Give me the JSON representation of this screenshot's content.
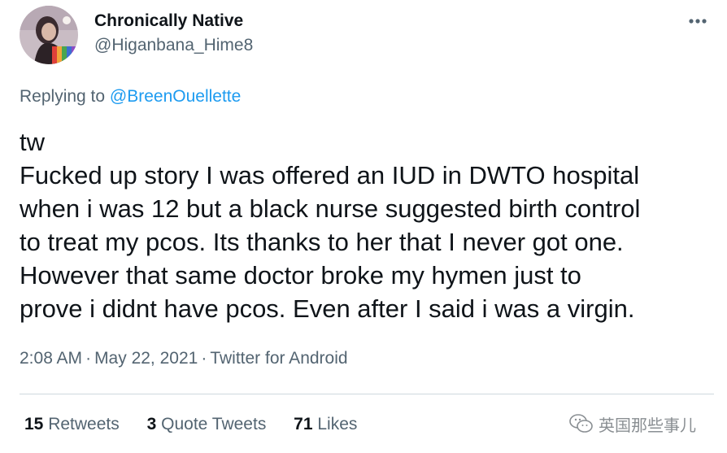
{
  "author": {
    "display_name": "Chronically Native",
    "handle": "@Higanbana_Hime8"
  },
  "reply": {
    "prefix": "Replying to",
    "target": "@BreenOuellette"
  },
  "tweet": {
    "lines": [
      "tw",
      "Fucked up story I was offered an IUD in DWTO hospital",
      "when i was 12 but a black nurse suggested birth control",
      "to treat my pcos. Its thanks to her that I never got one.",
      "However that same doctor broke my hymen just to",
      "prove i didnt have pcos. Even after I said i was a virgin."
    ]
  },
  "meta": {
    "time": "2:08 AM",
    "separator": "·",
    "date": "May 22, 2021",
    "source": "Twitter for Android"
  },
  "stats": {
    "retweets_count": "15",
    "retweets_label": "Retweets",
    "quotes_count": "3",
    "quotes_label": "Quote Tweets",
    "likes_count": "71",
    "likes_label": "Likes"
  },
  "watermark": {
    "text": "英国那些事儿",
    "icon": "wechat-icon"
  },
  "icons": {
    "more": "more-icon",
    "avatar": "avatar"
  },
  "colors": {
    "text_primary": "#0f1419",
    "text_secondary": "#536471",
    "link": "#1d9bf0",
    "divider": "#cfd9de"
  }
}
